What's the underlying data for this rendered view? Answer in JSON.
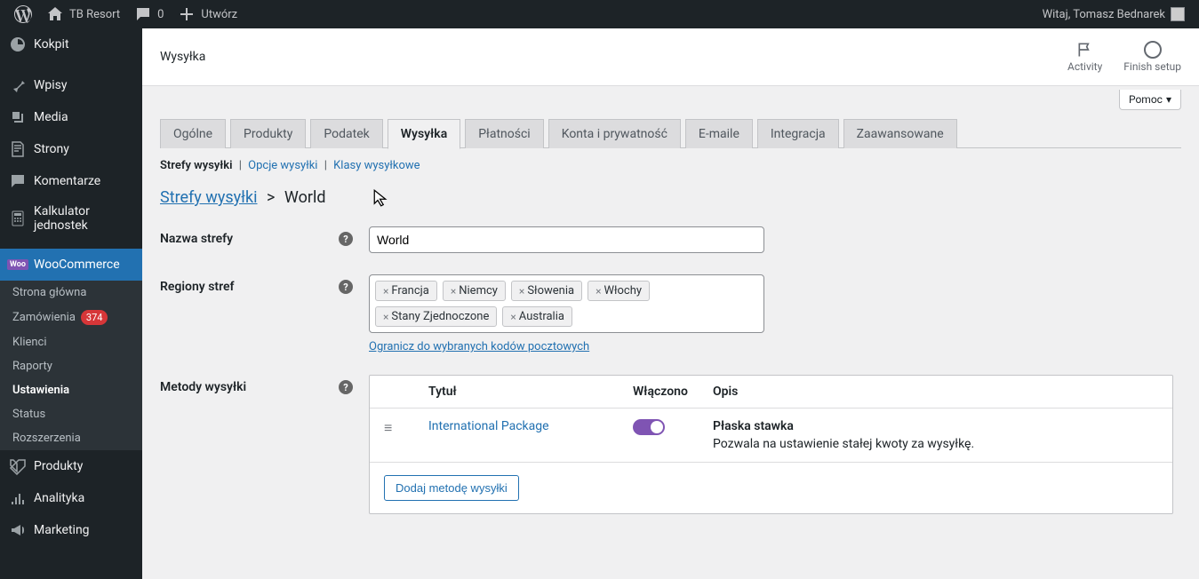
{
  "adminbar": {
    "site_name": "TB Resort",
    "comments": "0",
    "new": "Utwórz",
    "howdy": "Witaj, Tomasz Bednarek"
  },
  "sidebar": {
    "items": [
      {
        "label": "Kokpit"
      },
      {
        "label": "Wpisy"
      },
      {
        "label": "Media"
      },
      {
        "label": "Strony"
      },
      {
        "label": "Komentarze"
      },
      {
        "label": "Kalkulator jednostek"
      },
      {
        "label": "WooCommerce"
      },
      {
        "label": "Produkty"
      },
      {
        "label": "Analityka"
      },
      {
        "label": "Marketing"
      }
    ],
    "woo_sub": [
      {
        "label": "Strona główna"
      },
      {
        "label": "Zamówienia",
        "badge": "374"
      },
      {
        "label": "Klienci"
      },
      {
        "label": "Raporty"
      },
      {
        "label": "Ustawienia"
      },
      {
        "label": "Status"
      },
      {
        "label": "Rozszerzenia"
      }
    ]
  },
  "header": {
    "title": "Wysyłka",
    "activity": "Activity",
    "finish": "Finish setup",
    "help": "Pomoc"
  },
  "tabs": [
    "Ogólne",
    "Produkty",
    "Podatek",
    "Wysyłka",
    "Płatności",
    "Konta i prywatność",
    "E-maile",
    "Integracja",
    "Zaawansowane"
  ],
  "active_tab": "Wysyłka",
  "subtabs": {
    "zones": "Strefy wysyłki",
    "options": "Opcje wysyłki",
    "classes": "Klasy wysyłkowe"
  },
  "breadcrumb": {
    "link": "Strefy wysyłki",
    "current": "World"
  },
  "form": {
    "zone_name_label": "Nazwa strefy",
    "zone_name_value": "World",
    "regions_label": "Regiony stref",
    "regions": [
      "Francja",
      "Niemcy",
      "Słowenia",
      "Włochy",
      "Stany Zjednoczone",
      "Australia"
    ],
    "postal_link": "Ogranicz do wybranych kodów pocztowych",
    "methods_label": "Metody wysyłki"
  },
  "methods_table": {
    "col_title": "Tytuł",
    "col_enabled": "Włączono",
    "col_desc": "Opis",
    "row": {
      "title": "International Package",
      "desc_name": "Płaska stawka",
      "desc_text": "Pozwala na ustawienie stałej kwoty za wysyłkę."
    },
    "add_btn": "Dodaj metodę wysyłki"
  }
}
